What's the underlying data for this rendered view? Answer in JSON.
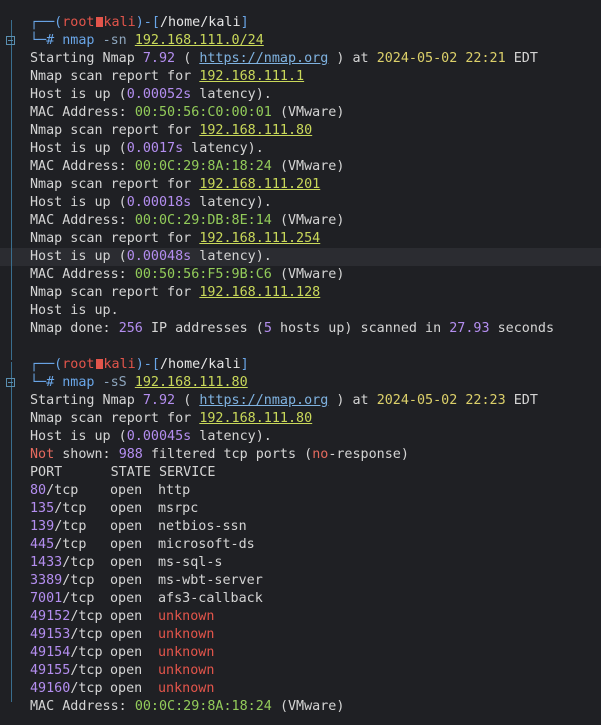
{
  "colors": {
    "background": "#1f2024",
    "prompt": "#6aa6e8",
    "root": "#e3554b",
    "number": "#b48ef0",
    "date": "#dcd06a",
    "mac": "#93cc5a"
  },
  "prompt1": {
    "open": "┌──(",
    "user": "root",
    "host": "kali",
    "sep": ")-[",
    "path": "/home/kali",
    "close": "]"
  },
  "cmd1": {
    "hash": "└─#",
    "cmd": "nmap",
    "flag": "-sn",
    "target": "192.168.111.0/24"
  },
  "scan1": {
    "start_a": "Starting Nmap",
    "version": "7.92",
    "paren_open": "(",
    "url": "https://nmap.org",
    "paren_close": ")",
    "at": "at",
    "datetime": "2024-05-02 22:21",
    "tz": "EDT",
    "hosts": [
      {
        "report": "Nmap scan report for",
        "ip": "192.168.111.1",
        "up_a": "Host is up (",
        "lat": "0.00052s",
        "up_b": " latency).",
        "mac_label": "MAC Address:",
        "mac": "00:50:56:C0:00:01",
        "vendor": "(VMware)"
      },
      {
        "report": "Nmap scan report for",
        "ip": "192.168.111.80",
        "up_a": "Host is up (",
        "lat": "0.0017s",
        "up_b": " latency).",
        "mac_label": "MAC Address:",
        "mac": "00:0C:29:8A:18:24",
        "vendor": "(VMware)"
      },
      {
        "report": "Nmap scan report for",
        "ip": "192.168.111.201",
        "up_a": "Host is up (",
        "lat": "0.00018s",
        "up_b": " latency).",
        "mac_label": "MAC Address:",
        "mac": "00:0C:29:DB:8E:14",
        "vendor": "(VMware)"
      },
      {
        "report": "Nmap scan report for",
        "ip": "192.168.111.254",
        "up_a": "Host is up (",
        "lat": "0.00048s",
        "up_b": " latency).",
        "mac_label": "MAC Address:",
        "mac": "00:50:56:F5:9B:C6",
        "vendor": "(VMware)"
      },
      {
        "report": "Nmap scan report for",
        "ip": "192.168.111.128",
        "up_a": "Host is up.",
        "lat": "",
        "up_b": "",
        "mac_label": "",
        "mac": "",
        "vendor": ""
      }
    ],
    "done_a": "Nmap done:",
    "done_n": "256",
    "done_b": "IP addresses (",
    "done_h": "5",
    "done_c": "hosts up) scanned in",
    "done_t": "27.93",
    "done_d": "seconds"
  },
  "prompt2": {
    "open": "┌──(",
    "user": "root",
    "host": "kali",
    "sep": ")-[",
    "path": "/home/kali",
    "close": "]"
  },
  "cmd2": {
    "hash": "└─#",
    "cmd": "nmap",
    "flag": "-sS",
    "target": "192.168.111.80"
  },
  "scan2": {
    "start_a": "Starting Nmap",
    "version": "7.92",
    "paren_open": "(",
    "url": "https://nmap.org",
    "paren_close": ")",
    "at": "at",
    "datetime": "2024-05-02 22:23",
    "tz": "EDT",
    "report": "Nmap scan report for",
    "ip": "192.168.111.80",
    "up_a": "Host is up (",
    "lat": "0.00045s",
    "up_b": " latency).",
    "ns_a": "Not",
    "ns_b": " shown:",
    "ns_n": "988",
    "ns_c": "filtered tcp ports (",
    "ns_d": "no",
    "ns_e": "-response)",
    "header": "PORT      STATE SERVICE",
    "ports": [
      {
        "num": "80",
        "proto": "/tcp",
        "state": "open",
        "service": "http",
        "unknown": false
      },
      {
        "num": "135",
        "proto": "/tcp",
        "state": "open",
        "service": "msrpc",
        "unknown": false
      },
      {
        "num": "139",
        "proto": "/tcp",
        "state": "open",
        "service": "netbios-ssn",
        "unknown": false
      },
      {
        "num": "445",
        "proto": "/tcp",
        "state": "open",
        "service": "microsoft-ds",
        "unknown": false
      },
      {
        "num": "1433",
        "proto": "/tcp",
        "state": "open",
        "service": "ms-sql-s",
        "unknown": false
      },
      {
        "num": "3389",
        "proto": "/tcp",
        "state": "open",
        "service": "ms-wbt-server",
        "unknown": false
      },
      {
        "num": "7001",
        "proto": "/tcp",
        "state": "open",
        "service": "afs3-callback",
        "unknown": false
      },
      {
        "num": "49152",
        "proto": "/tcp",
        "state": "open",
        "service": "unknown",
        "unknown": true
      },
      {
        "num": "49153",
        "proto": "/tcp",
        "state": "open",
        "service": "unknown",
        "unknown": true
      },
      {
        "num": "49154",
        "proto": "/tcp",
        "state": "open",
        "service": "unknown",
        "unknown": true
      },
      {
        "num": "49155",
        "proto": "/tcp",
        "state": "open",
        "service": "unknown",
        "unknown": true
      },
      {
        "num": "49160",
        "proto": "/tcp",
        "state": "open",
        "service": "unknown",
        "unknown": true
      }
    ],
    "mac_label": "MAC Address:",
    "mac": "00:0C:29:8A:18:24",
    "vendor": "(VMware)"
  }
}
